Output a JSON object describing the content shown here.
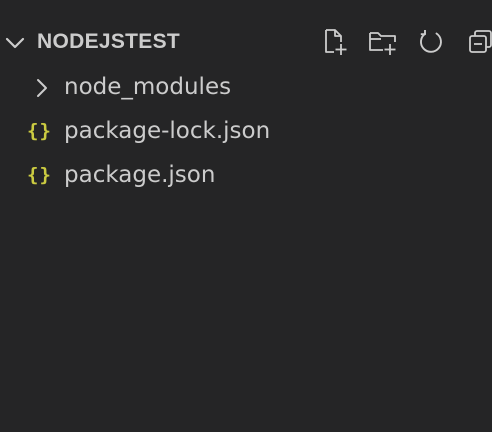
{
  "explorer": {
    "folder_name": "NODEJSTEST",
    "actions": [
      {
        "name": "new-file",
        "icon": "new-file-icon"
      },
      {
        "name": "new-folder",
        "icon": "new-folder-icon"
      },
      {
        "name": "refresh",
        "icon": "refresh-icon"
      },
      {
        "name": "collapse-all",
        "icon": "collapse-all-icon"
      }
    ],
    "items": [
      {
        "type": "folder",
        "label": "node_modules",
        "icon": "chevron-right-icon"
      },
      {
        "type": "file",
        "label": "package-lock.json",
        "icon": "json-icon",
        "icon_text": "{}"
      },
      {
        "type": "file",
        "label": "package.json",
        "icon": "json-icon",
        "icon_text": "{}"
      }
    ]
  },
  "colors": {
    "background": "#252526",
    "text": "#cccccc",
    "json_icon": "#cbcb41"
  }
}
